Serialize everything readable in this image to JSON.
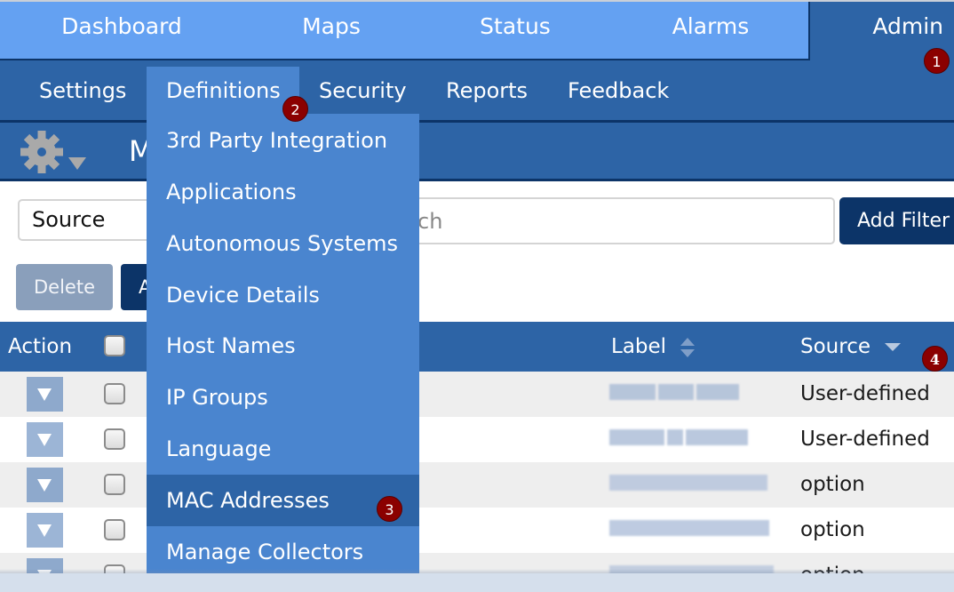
{
  "top_nav": {
    "items": [
      {
        "label": "Dashboard"
      },
      {
        "label": "Maps"
      },
      {
        "label": "Status"
      },
      {
        "label": "Alarms"
      }
    ],
    "active": {
      "label": "Admin"
    }
  },
  "sub_nav": {
    "items": [
      {
        "label": "Settings"
      },
      {
        "label": "Definitions",
        "active": true
      },
      {
        "label": "Security"
      },
      {
        "label": "Reports"
      },
      {
        "label": "Feedback"
      }
    ]
  },
  "page_header": {
    "icon": "gear-icon",
    "title_visible": "M"
  },
  "filter": {
    "field_value": "Source",
    "search_placeholder": "Search",
    "search_visible": "arch",
    "add_filter_label": "Add Filter"
  },
  "actions": {
    "delete_label": "Delete",
    "add_label_visible": "A"
  },
  "table": {
    "columns": [
      {
        "label": "Action"
      },
      {
        "label": "Label",
        "sort": "unsorted"
      },
      {
        "label": "Source",
        "sort": "descending"
      }
    ],
    "rows": [
      {
        "label": "[redacted]",
        "source": "User-defined"
      },
      {
        "label": "[redacted]",
        "source": "User-defined"
      },
      {
        "label": "[redacted]",
        "source": "option"
      },
      {
        "label": "[redacted]",
        "source": "option"
      },
      {
        "label": "[redacted]",
        "source": "option"
      }
    ]
  },
  "definitions_menu": {
    "items": [
      {
        "label": "3rd Party Integration"
      },
      {
        "label": "Applications"
      },
      {
        "label": "Autonomous Systems"
      },
      {
        "label": "Device Details"
      },
      {
        "label": "Host Names"
      },
      {
        "label": "IP Groups"
      },
      {
        "label": "Language"
      },
      {
        "label": "MAC Addresses",
        "highlighted": true
      },
      {
        "label": "Manage Collectors"
      }
    ]
  },
  "callouts": {
    "step1": "1",
    "step2": "2",
    "step3": "3",
    "step4": "4"
  },
  "colors": {
    "top_nav_bg": "#64a1f2",
    "primary": "#2d64a6",
    "dark": "#0c3468",
    "menu_bg": "#4a85cf",
    "badge": "#8b0000"
  }
}
